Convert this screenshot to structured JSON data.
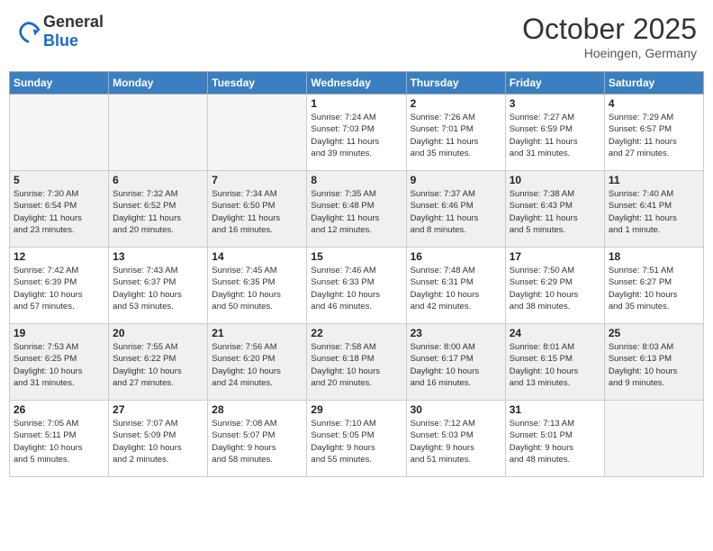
{
  "header": {
    "logo_general": "General",
    "logo_blue": "Blue",
    "month_title": "October 2025",
    "location": "Hoeingen, Germany"
  },
  "weekdays": [
    "Sunday",
    "Monday",
    "Tuesday",
    "Wednesday",
    "Thursday",
    "Friday",
    "Saturday"
  ],
  "weeks": [
    [
      {
        "day": "",
        "info": ""
      },
      {
        "day": "",
        "info": ""
      },
      {
        "day": "",
        "info": ""
      },
      {
        "day": "1",
        "info": "Sunrise: 7:24 AM\nSunset: 7:03 PM\nDaylight: 11 hours\nand 39 minutes."
      },
      {
        "day": "2",
        "info": "Sunrise: 7:26 AM\nSunset: 7:01 PM\nDaylight: 11 hours\nand 35 minutes."
      },
      {
        "day": "3",
        "info": "Sunrise: 7:27 AM\nSunset: 6:59 PM\nDaylight: 11 hours\nand 31 minutes."
      },
      {
        "day": "4",
        "info": "Sunrise: 7:29 AM\nSunset: 6:57 PM\nDaylight: 11 hours\nand 27 minutes."
      }
    ],
    [
      {
        "day": "5",
        "info": "Sunrise: 7:30 AM\nSunset: 6:54 PM\nDaylight: 11 hours\nand 23 minutes."
      },
      {
        "day": "6",
        "info": "Sunrise: 7:32 AM\nSunset: 6:52 PM\nDaylight: 11 hours\nand 20 minutes."
      },
      {
        "day": "7",
        "info": "Sunrise: 7:34 AM\nSunset: 6:50 PM\nDaylight: 11 hours\nand 16 minutes."
      },
      {
        "day": "8",
        "info": "Sunrise: 7:35 AM\nSunset: 6:48 PM\nDaylight: 11 hours\nand 12 minutes."
      },
      {
        "day": "9",
        "info": "Sunrise: 7:37 AM\nSunset: 6:46 PM\nDaylight: 11 hours\nand 8 minutes."
      },
      {
        "day": "10",
        "info": "Sunrise: 7:38 AM\nSunset: 6:43 PM\nDaylight: 11 hours\nand 5 minutes."
      },
      {
        "day": "11",
        "info": "Sunrise: 7:40 AM\nSunset: 6:41 PM\nDaylight: 11 hours\nand 1 minute."
      }
    ],
    [
      {
        "day": "12",
        "info": "Sunrise: 7:42 AM\nSunset: 6:39 PM\nDaylight: 10 hours\nand 57 minutes."
      },
      {
        "day": "13",
        "info": "Sunrise: 7:43 AM\nSunset: 6:37 PM\nDaylight: 10 hours\nand 53 minutes."
      },
      {
        "day": "14",
        "info": "Sunrise: 7:45 AM\nSunset: 6:35 PM\nDaylight: 10 hours\nand 50 minutes."
      },
      {
        "day": "15",
        "info": "Sunrise: 7:46 AM\nSunset: 6:33 PM\nDaylight: 10 hours\nand 46 minutes."
      },
      {
        "day": "16",
        "info": "Sunrise: 7:48 AM\nSunset: 6:31 PM\nDaylight: 10 hours\nand 42 minutes."
      },
      {
        "day": "17",
        "info": "Sunrise: 7:50 AM\nSunset: 6:29 PM\nDaylight: 10 hours\nand 38 minutes."
      },
      {
        "day": "18",
        "info": "Sunrise: 7:51 AM\nSunset: 6:27 PM\nDaylight: 10 hours\nand 35 minutes."
      }
    ],
    [
      {
        "day": "19",
        "info": "Sunrise: 7:53 AM\nSunset: 6:25 PM\nDaylight: 10 hours\nand 31 minutes."
      },
      {
        "day": "20",
        "info": "Sunrise: 7:55 AM\nSunset: 6:22 PM\nDaylight: 10 hours\nand 27 minutes."
      },
      {
        "day": "21",
        "info": "Sunrise: 7:56 AM\nSunset: 6:20 PM\nDaylight: 10 hours\nand 24 minutes."
      },
      {
        "day": "22",
        "info": "Sunrise: 7:58 AM\nSunset: 6:18 PM\nDaylight: 10 hours\nand 20 minutes."
      },
      {
        "day": "23",
        "info": "Sunrise: 8:00 AM\nSunset: 6:17 PM\nDaylight: 10 hours\nand 16 minutes."
      },
      {
        "day": "24",
        "info": "Sunrise: 8:01 AM\nSunset: 6:15 PM\nDaylight: 10 hours\nand 13 minutes."
      },
      {
        "day": "25",
        "info": "Sunrise: 8:03 AM\nSunset: 6:13 PM\nDaylight: 10 hours\nand 9 minutes."
      }
    ],
    [
      {
        "day": "26",
        "info": "Sunrise: 7:05 AM\nSunset: 5:11 PM\nDaylight: 10 hours\nand 5 minutes."
      },
      {
        "day": "27",
        "info": "Sunrise: 7:07 AM\nSunset: 5:09 PM\nDaylight: 10 hours\nand 2 minutes."
      },
      {
        "day": "28",
        "info": "Sunrise: 7:08 AM\nSunset: 5:07 PM\nDaylight: 9 hours\nand 58 minutes."
      },
      {
        "day": "29",
        "info": "Sunrise: 7:10 AM\nSunset: 5:05 PM\nDaylight: 9 hours\nand 55 minutes."
      },
      {
        "day": "30",
        "info": "Sunrise: 7:12 AM\nSunset: 5:03 PM\nDaylight: 9 hours\nand 51 minutes."
      },
      {
        "day": "31",
        "info": "Sunrise: 7:13 AM\nSunset: 5:01 PM\nDaylight: 9 hours\nand 48 minutes."
      },
      {
        "day": "",
        "info": ""
      }
    ]
  ]
}
